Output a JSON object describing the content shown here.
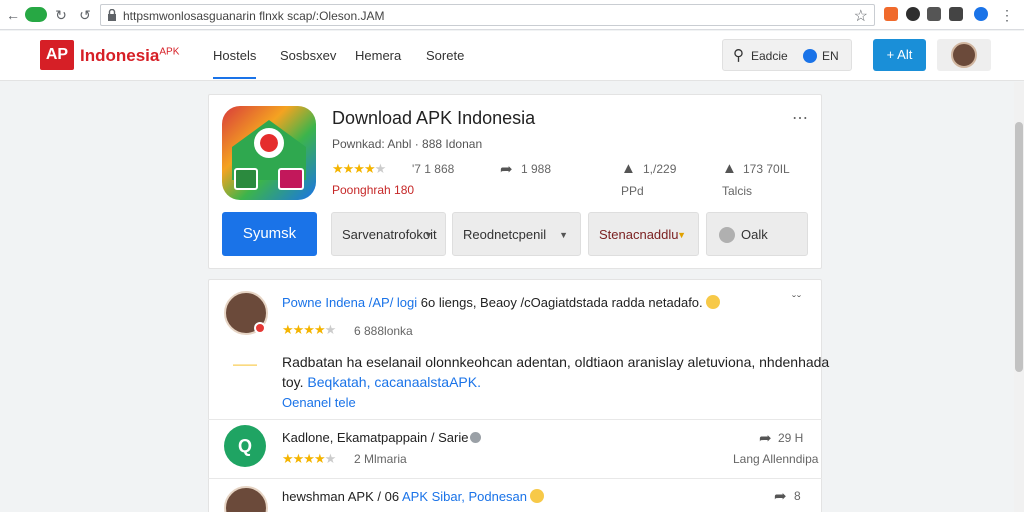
{
  "browser": {
    "url": "httpsmwonlosasguanarin flnxk scap/:Oleson.JAM",
    "colors": {
      "accent": "#1a73e8"
    }
  },
  "site": {
    "logo_badge": "AP",
    "logo_text": "Indonesia",
    "logo_sub": "APK",
    "nav": [
      "Hostels",
      "Sosbsxev",
      "Hemera",
      "Sorete"
    ],
    "search_label": "Eadcie",
    "search_lang": "EN",
    "add_label": "+ Alt"
  },
  "app": {
    "title": "Download APK Indonesia",
    "subtitle": "Pownkad: Anbl · 888 Idonan",
    "rating_count": "'7 1 868",
    "rating_label": "Poonghrah 180",
    "stats": [
      {
        "icon": "share-icon",
        "value": "1 988",
        "label": ""
      },
      {
        "icon": "thumb-icon",
        "value": "1,/229",
        "label": "PPd"
      },
      {
        "icon": "like-icon",
        "value": "173 70IL",
        "label": "Talcis"
      }
    ],
    "buttons": {
      "primary": "Syumsk",
      "b1": "Sarvenatrofokoit",
      "b2": "Reodnetcpenil",
      "b3": "Stenacnaddlu",
      "b4": "Oalk"
    }
  },
  "reviews": [
    {
      "head_blue": "Powne Indena /AP/ logi",
      "head_rest": "6o liengs, Beaoy /cOagiatdstada radda netadafo.",
      "meta": "6 888lonka",
      "body1": "Radbatan ha eselanail olonnkeohcan adentan, oldtiaon aranislay aletuviona, nhdenhada",
      "body2_plain": "toy.",
      "body2_link": "Beqkatah, cacanaalstaAPK.",
      "link": "Oenanel tele"
    },
    {
      "head": "Kadlone, Ekamatpappain / Sarie",
      "meta": "2 Mlmaria",
      "count": "29 H",
      "right_label": "Lang Allenndipa"
    },
    {
      "head_plain": "hewshman APK / 06",
      "head_blue": "APK Sibar, Podnesan",
      "count": "8"
    }
  ]
}
